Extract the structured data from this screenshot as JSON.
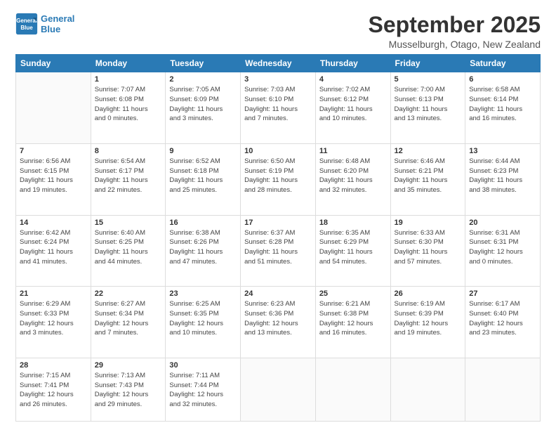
{
  "logo": {
    "line1": "General",
    "line2": "Blue"
  },
  "title": "September 2025",
  "location": "Musselburgh, Otago, New Zealand",
  "days_of_week": [
    "Sunday",
    "Monday",
    "Tuesday",
    "Wednesday",
    "Thursday",
    "Friday",
    "Saturday"
  ],
  "weeks": [
    [
      {
        "num": "",
        "info": ""
      },
      {
        "num": "1",
        "info": "Sunrise: 7:07 AM\nSunset: 6:08 PM\nDaylight: 11 hours\nand 0 minutes."
      },
      {
        "num": "2",
        "info": "Sunrise: 7:05 AM\nSunset: 6:09 PM\nDaylight: 11 hours\nand 3 minutes."
      },
      {
        "num": "3",
        "info": "Sunrise: 7:03 AM\nSunset: 6:10 PM\nDaylight: 11 hours\nand 7 minutes."
      },
      {
        "num": "4",
        "info": "Sunrise: 7:02 AM\nSunset: 6:12 PM\nDaylight: 11 hours\nand 10 minutes."
      },
      {
        "num": "5",
        "info": "Sunrise: 7:00 AM\nSunset: 6:13 PM\nDaylight: 11 hours\nand 13 minutes."
      },
      {
        "num": "6",
        "info": "Sunrise: 6:58 AM\nSunset: 6:14 PM\nDaylight: 11 hours\nand 16 minutes."
      }
    ],
    [
      {
        "num": "7",
        "info": "Sunrise: 6:56 AM\nSunset: 6:15 PM\nDaylight: 11 hours\nand 19 minutes."
      },
      {
        "num": "8",
        "info": "Sunrise: 6:54 AM\nSunset: 6:17 PM\nDaylight: 11 hours\nand 22 minutes."
      },
      {
        "num": "9",
        "info": "Sunrise: 6:52 AM\nSunset: 6:18 PM\nDaylight: 11 hours\nand 25 minutes."
      },
      {
        "num": "10",
        "info": "Sunrise: 6:50 AM\nSunset: 6:19 PM\nDaylight: 11 hours\nand 28 minutes."
      },
      {
        "num": "11",
        "info": "Sunrise: 6:48 AM\nSunset: 6:20 PM\nDaylight: 11 hours\nand 32 minutes."
      },
      {
        "num": "12",
        "info": "Sunrise: 6:46 AM\nSunset: 6:21 PM\nDaylight: 11 hours\nand 35 minutes."
      },
      {
        "num": "13",
        "info": "Sunrise: 6:44 AM\nSunset: 6:23 PM\nDaylight: 11 hours\nand 38 minutes."
      }
    ],
    [
      {
        "num": "14",
        "info": "Sunrise: 6:42 AM\nSunset: 6:24 PM\nDaylight: 11 hours\nand 41 minutes."
      },
      {
        "num": "15",
        "info": "Sunrise: 6:40 AM\nSunset: 6:25 PM\nDaylight: 11 hours\nand 44 minutes."
      },
      {
        "num": "16",
        "info": "Sunrise: 6:38 AM\nSunset: 6:26 PM\nDaylight: 11 hours\nand 47 minutes."
      },
      {
        "num": "17",
        "info": "Sunrise: 6:37 AM\nSunset: 6:28 PM\nDaylight: 11 hours\nand 51 minutes."
      },
      {
        "num": "18",
        "info": "Sunrise: 6:35 AM\nSunset: 6:29 PM\nDaylight: 11 hours\nand 54 minutes."
      },
      {
        "num": "19",
        "info": "Sunrise: 6:33 AM\nSunset: 6:30 PM\nDaylight: 11 hours\nand 57 minutes."
      },
      {
        "num": "20",
        "info": "Sunrise: 6:31 AM\nSunset: 6:31 PM\nDaylight: 12 hours\nand 0 minutes."
      }
    ],
    [
      {
        "num": "21",
        "info": "Sunrise: 6:29 AM\nSunset: 6:33 PM\nDaylight: 12 hours\nand 3 minutes."
      },
      {
        "num": "22",
        "info": "Sunrise: 6:27 AM\nSunset: 6:34 PM\nDaylight: 12 hours\nand 7 minutes."
      },
      {
        "num": "23",
        "info": "Sunrise: 6:25 AM\nSunset: 6:35 PM\nDaylight: 12 hours\nand 10 minutes."
      },
      {
        "num": "24",
        "info": "Sunrise: 6:23 AM\nSunset: 6:36 PM\nDaylight: 12 hours\nand 13 minutes."
      },
      {
        "num": "25",
        "info": "Sunrise: 6:21 AM\nSunset: 6:38 PM\nDaylight: 12 hours\nand 16 minutes."
      },
      {
        "num": "26",
        "info": "Sunrise: 6:19 AM\nSunset: 6:39 PM\nDaylight: 12 hours\nand 19 minutes."
      },
      {
        "num": "27",
        "info": "Sunrise: 6:17 AM\nSunset: 6:40 PM\nDaylight: 12 hours\nand 23 minutes."
      }
    ],
    [
      {
        "num": "28",
        "info": "Sunrise: 7:15 AM\nSunset: 7:41 PM\nDaylight: 12 hours\nand 26 minutes."
      },
      {
        "num": "29",
        "info": "Sunrise: 7:13 AM\nSunset: 7:43 PM\nDaylight: 12 hours\nand 29 minutes."
      },
      {
        "num": "30",
        "info": "Sunrise: 7:11 AM\nSunset: 7:44 PM\nDaylight: 12 hours\nand 32 minutes."
      },
      {
        "num": "",
        "info": ""
      },
      {
        "num": "",
        "info": ""
      },
      {
        "num": "",
        "info": ""
      },
      {
        "num": "",
        "info": ""
      }
    ]
  ]
}
